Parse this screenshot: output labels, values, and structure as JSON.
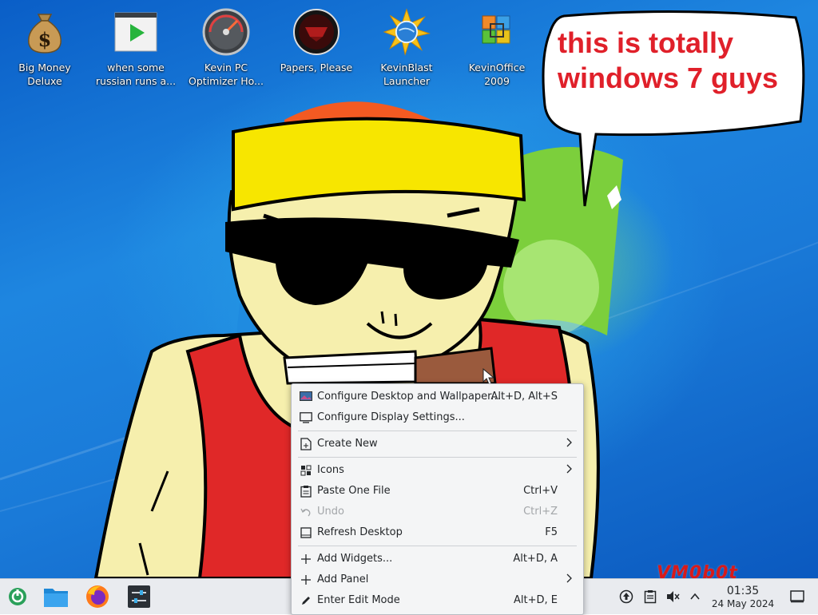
{
  "desktop_icons": [
    {
      "name": "Big Money\nDeluxe",
      "icon": "money-bag-icon"
    },
    {
      "name": "when some\nrussian runs a...",
      "icon": "video-file-icon"
    },
    {
      "name": "Kevin PC\nOptimizer Ho...",
      "icon": "speedometer-icon"
    },
    {
      "name": "Papers, Please",
      "icon": "papers-please-icon"
    },
    {
      "name": "KevinBlast\nLauncher",
      "icon": "starburst-globe-icon"
    },
    {
      "name": "KevinOffice\n2009",
      "icon": "office-logo-icon"
    }
  ],
  "speech_bubble": {
    "text": "this is totally\nwindows 7 guys"
  },
  "watermark": {
    "text": "VM0b0t"
  },
  "context_menu": {
    "items": [
      {
        "label": "Configure Desktop and Wallpaper...",
        "shortcut": "Alt+D, Alt+S",
        "icon": "wallpaper-icon"
      },
      {
        "label": "Configure Display Settings...",
        "shortcut": "",
        "icon": "display-icon"
      },
      {
        "label": "Create New",
        "shortcut": "",
        "icon": "new-file-icon",
        "submenu": true
      },
      {
        "label": "Icons",
        "shortcut": "",
        "icon": "icons-grid-icon",
        "submenu": true
      },
      {
        "label": "Paste One File",
        "shortcut": "Ctrl+V",
        "icon": "paste-icon"
      },
      {
        "label": "Undo",
        "shortcut": "Ctrl+Z",
        "icon": "undo-icon",
        "disabled": true
      },
      {
        "label": "Refresh Desktop",
        "shortcut": "F5",
        "icon": "refresh-icon"
      },
      {
        "label": "Add Widgets...",
        "shortcut": "Alt+D, A",
        "icon": "plus-icon"
      },
      {
        "label": "Add Panel",
        "shortcut": "",
        "icon": "plus-icon",
        "submenu": true
      },
      {
        "label": "Enter Edit Mode",
        "shortcut": "Alt+D, E",
        "icon": "pencil-icon"
      }
    ]
  },
  "taskbar": {
    "launchers": [
      "app-launcher-icon",
      "file-manager-icon",
      "firefox-icon",
      "system-settings-icon"
    ],
    "tray_icons": [
      "updates-icon",
      "clipboard-icon",
      "volume-muted-icon",
      "chevron-up-icon"
    ],
    "clock": {
      "time": "01:35",
      "date": "24 May 2024"
    },
    "show_desktop_icon": "show-desktop-icon"
  },
  "colors": {
    "taskbar_bg": "#e9ebef",
    "menu_bg": "#f4f5f6",
    "bubble_text": "#e0202a",
    "accent_blue": "#1a7ad8"
  }
}
